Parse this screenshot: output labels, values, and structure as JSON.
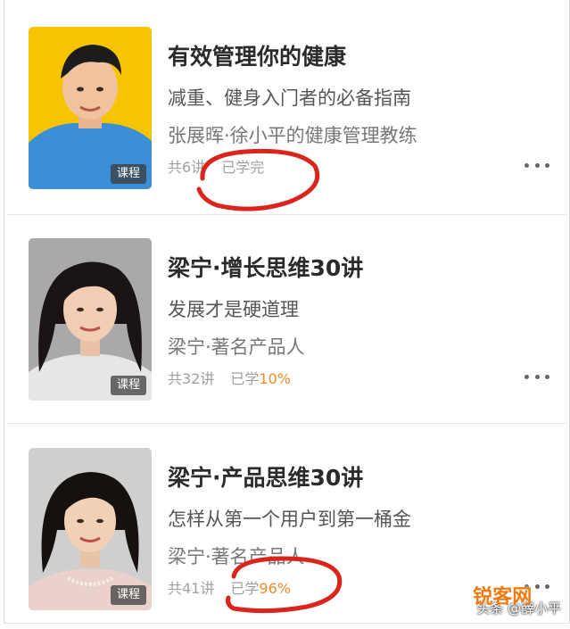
{
  "courses": [
    {
      "title": "有效管理你的健康",
      "subtitle": "减重、健身入门者的必备指南",
      "author": "张展晖·徐小平的健康管理教练",
      "lessons": "共6讲",
      "progress_prefix": "已学完",
      "progress_value": "",
      "badge": "课程"
    },
    {
      "title": "梁宁·增长思维30讲",
      "subtitle": "发展才是硬道理",
      "author": "梁宁·著名产品人",
      "lessons": "共32讲",
      "progress_prefix": "已学",
      "progress_value": "10%",
      "badge": "课程"
    },
    {
      "title": "梁宁·产品思维30讲",
      "subtitle": "怎样从第一个用户到第一桶金",
      "author": "梁宁·著名产品人",
      "lessons": "共41讲",
      "progress_prefix": "已学",
      "progress_value": "96%",
      "badge": "课程"
    }
  ],
  "watermark": {
    "logo": "锐客网",
    "text": "头条 @薛小平"
  },
  "colors": {
    "accent": "#f08a2a",
    "annotation": "#d9251c",
    "thumb1_bg": "#f5c300"
  },
  "icons": {
    "more": "more-dots-icon"
  }
}
